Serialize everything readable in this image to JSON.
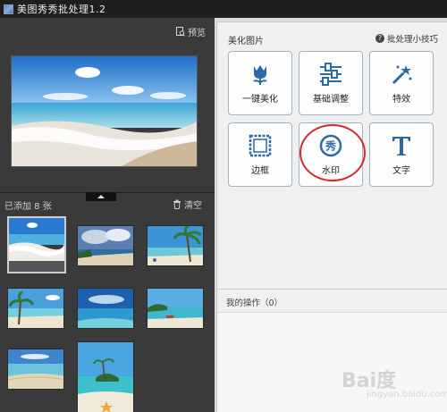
{
  "window": {
    "title": "美图秀秀批处理1.2"
  },
  "left_panel": {
    "preview_label": "预览",
    "added_label": "已添加 8 张",
    "clear_label": "清空",
    "thumbnails": [
      {
        "name": "beach-waves",
        "selected": true
      },
      {
        "name": "cloudy-beach",
        "selected": false
      },
      {
        "name": "palm-beach",
        "selected": false
      },
      {
        "name": "palm-shore",
        "selected": false
      },
      {
        "name": "open-sea",
        "selected": false
      },
      {
        "name": "island-boat",
        "selected": false
      },
      {
        "name": "calm-bay",
        "selected": false
      },
      {
        "name": "starfish-island",
        "selected": false
      }
    ]
  },
  "right_panel": {
    "section_title": "美化图片",
    "tips_label": "批处理小技巧",
    "tools": [
      {
        "label": "一键美化",
        "icon": "tulip-icon"
      },
      {
        "label": "基础调整",
        "icon": "sliders-icon"
      },
      {
        "label": "特效",
        "icon": "magic-wand-icon"
      },
      {
        "label": "边框",
        "icon": "frame-icon"
      },
      {
        "label": "水印",
        "icon": "watermark-icon",
        "highlighted": true
      },
      {
        "label": "文字",
        "icon": "text-icon"
      }
    ],
    "operations_label": "我的操作（0）"
  },
  "watermark": {
    "brand": "Bai度",
    "sub": "jingyan.baidu.com"
  },
  "colors": {
    "accent": "#2a6aa8",
    "highlight_ring": "#d42a2a",
    "sky": "#2e7fd0"
  }
}
